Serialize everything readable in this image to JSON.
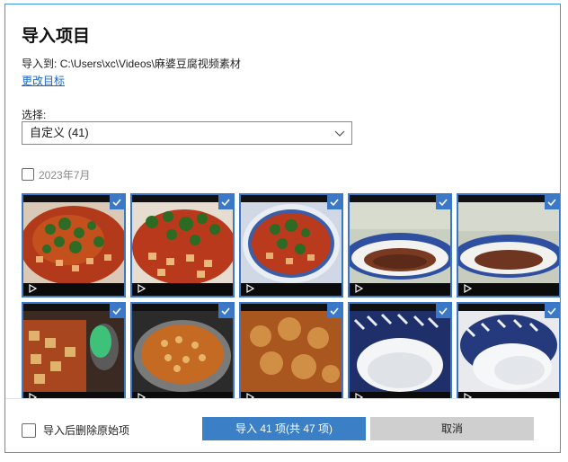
{
  "dialog": {
    "title": "导入项目",
    "destination_label": "导入到:",
    "destination_path": "C:\\Users\\xc\\Videos\\麻婆豆腐视频素材",
    "change_target": "更改目标",
    "select_label": "选择:",
    "select_value": "自定义 (41)",
    "group_label": "2023年7月"
  },
  "thumbnails": [
    {
      "name": "video-thumb-1",
      "scene": "mapo-tofu-herbs",
      "selected": true
    },
    {
      "name": "video-thumb-2",
      "scene": "mapo-tofu-herbs",
      "selected": true
    },
    {
      "name": "video-thumb-3",
      "scene": "mapo-tofu-herbs-bowl",
      "selected": true
    },
    {
      "name": "video-thumb-4",
      "scene": "empty-plate",
      "selected": true
    },
    {
      "name": "video-thumb-5",
      "scene": "empty-plate",
      "selected": true
    },
    {
      "name": "video-thumb-6",
      "scene": "tofu-closeup-spoon",
      "selected": true
    },
    {
      "name": "video-thumb-7",
      "scene": "pan-tofu-sauce",
      "selected": true
    },
    {
      "name": "video-thumb-8",
      "scene": "blurred-tofu",
      "selected": true
    },
    {
      "name": "video-thumb-9",
      "scene": "white-liquid-bowl",
      "selected": true
    },
    {
      "name": "video-thumb-10",
      "scene": "white-powder-bowl",
      "selected": true
    }
  ],
  "footer": {
    "delete_option": "导入后删除原始项",
    "import_button": "导入 41 项(共 47 项)",
    "cancel_button": "取消"
  },
  "colors": {
    "accent": "#3b78c8",
    "link": "#1a66c4",
    "dialog_border": "#3c9bd6"
  }
}
